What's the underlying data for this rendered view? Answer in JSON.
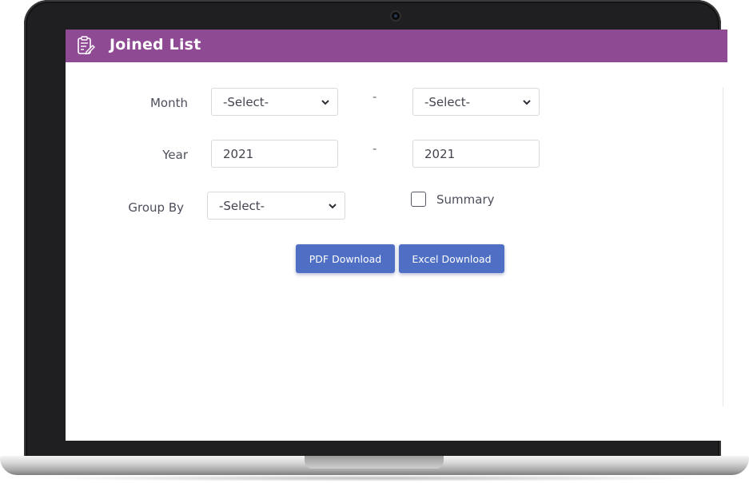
{
  "header": {
    "title": "Joined List",
    "icon": "clipboard-edit-icon"
  },
  "form": {
    "month": {
      "label": "Month",
      "from_value": "-Select-",
      "to_value": "-Select-",
      "separator": "-"
    },
    "year": {
      "label": "Year",
      "from_value": "2021",
      "to_value": "2021",
      "separator": "-"
    },
    "group_by": {
      "label": "Group By",
      "value": "-Select-"
    },
    "summary": {
      "label": "Summary",
      "checked": false
    }
  },
  "actions": {
    "pdf_label": "PDF Download",
    "excel_label": "Excel Download"
  },
  "colors": {
    "header": "#8e4a93",
    "button": "#4e6fc4",
    "bezel": "#1f1f21"
  }
}
